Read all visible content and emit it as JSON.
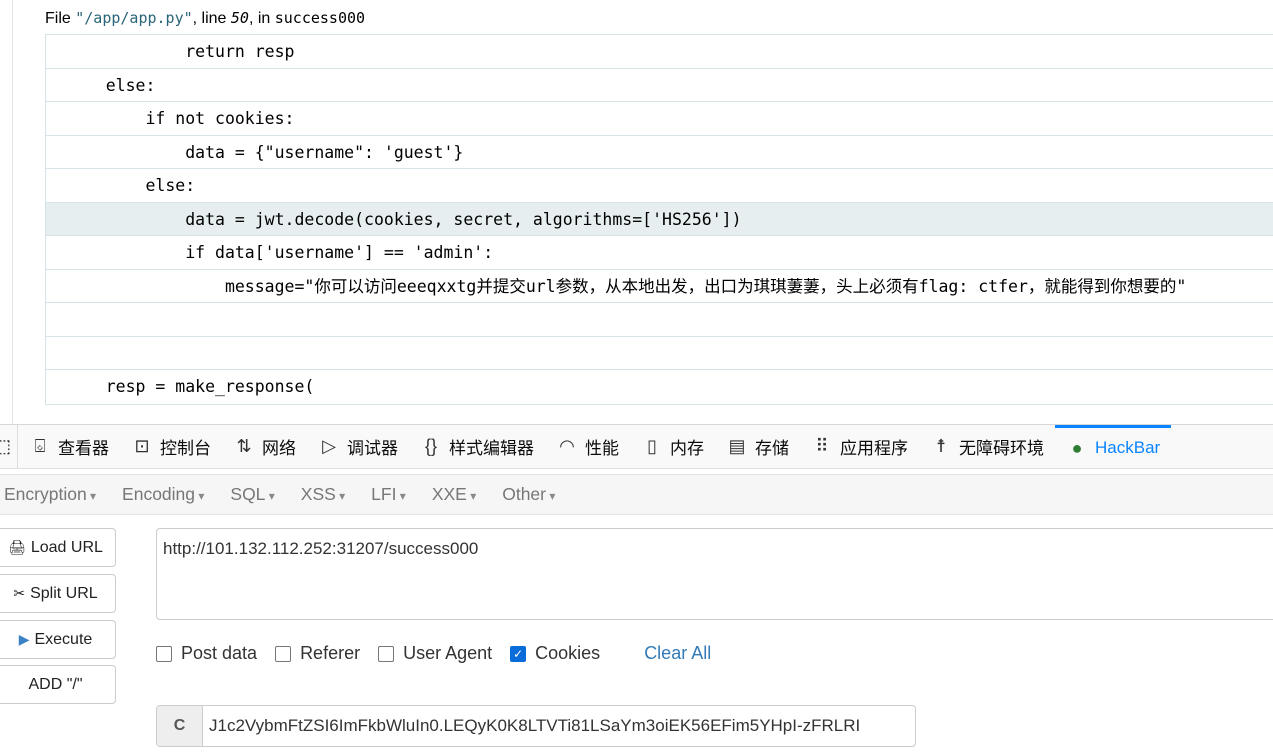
{
  "traceback": {
    "prefix": "File ",
    "filename": "\"/app/app.py\"",
    "line_label": ", line ",
    "line_no": "50",
    "in_label": ", in ",
    "function": "success000",
    "code_lines": [
      "            return resp",
      "    else:",
      "        if not cookies:",
      "            data = {\"username\": 'guest'}",
      "        else:",
      "            data = jwt.decode(cookies, secret, algorithms=['HS256'])",
      "            if data['username'] == 'admin':",
      "                message=\"你可以访问eeeqxxtg并提交url参数，从本地出发，出口为琪琪萋萋，头上必须有flag: ctfer，就能得到你想要的\"",
      "",
      "",
      "    resp = make_response("
    ],
    "highlighted_line_index": 5
  },
  "devtools": {
    "tabs": [
      {
        "label": "查看器",
        "icon": "inspector-icon"
      },
      {
        "label": "控制台",
        "icon": "console-icon"
      },
      {
        "label": "网络",
        "icon": "network-icon"
      },
      {
        "label": "调试器",
        "icon": "debugger-icon"
      },
      {
        "label": "样式编辑器",
        "icon": "style-editor-icon"
      },
      {
        "label": "性能",
        "icon": "performance-icon"
      },
      {
        "label": "内存",
        "icon": "memory-icon"
      },
      {
        "label": "存储",
        "icon": "storage-icon"
      },
      {
        "label": "应用程序",
        "icon": "application-icon"
      },
      {
        "label": "无障碍环境",
        "icon": "accessibility-icon"
      },
      {
        "label": "HackBar",
        "icon": "hackbar-icon",
        "active": true
      }
    ],
    "active_color": "#0a84ff"
  },
  "hackbar": {
    "menus": [
      "Encryption",
      "Encoding",
      "SQL",
      "XSS",
      "LFI",
      "XXE",
      "Other"
    ],
    "buttons": {
      "load_url": "Load URL",
      "split_url": "Split URL",
      "execute": "Execute",
      "add_slash": "ADD \"/\""
    },
    "url_value": "http://101.132.112.252:31207/success000",
    "options": {
      "post_data": {
        "label": "Post data",
        "checked": false
      },
      "referer": {
        "label": "Referer",
        "checked": false
      },
      "user_agent": {
        "label": "User Agent",
        "checked": false
      },
      "cookies": {
        "label": "Cookies",
        "checked": true
      }
    },
    "clear_all": "Clear All",
    "cookie_addon": "C",
    "cookie_value": "J1c2VybmFtZSI6ImFkbWluIn0.LEQyK0K8LTVTi81LSaYm3oiEK56EFim5YHpI-zFRLRI"
  }
}
